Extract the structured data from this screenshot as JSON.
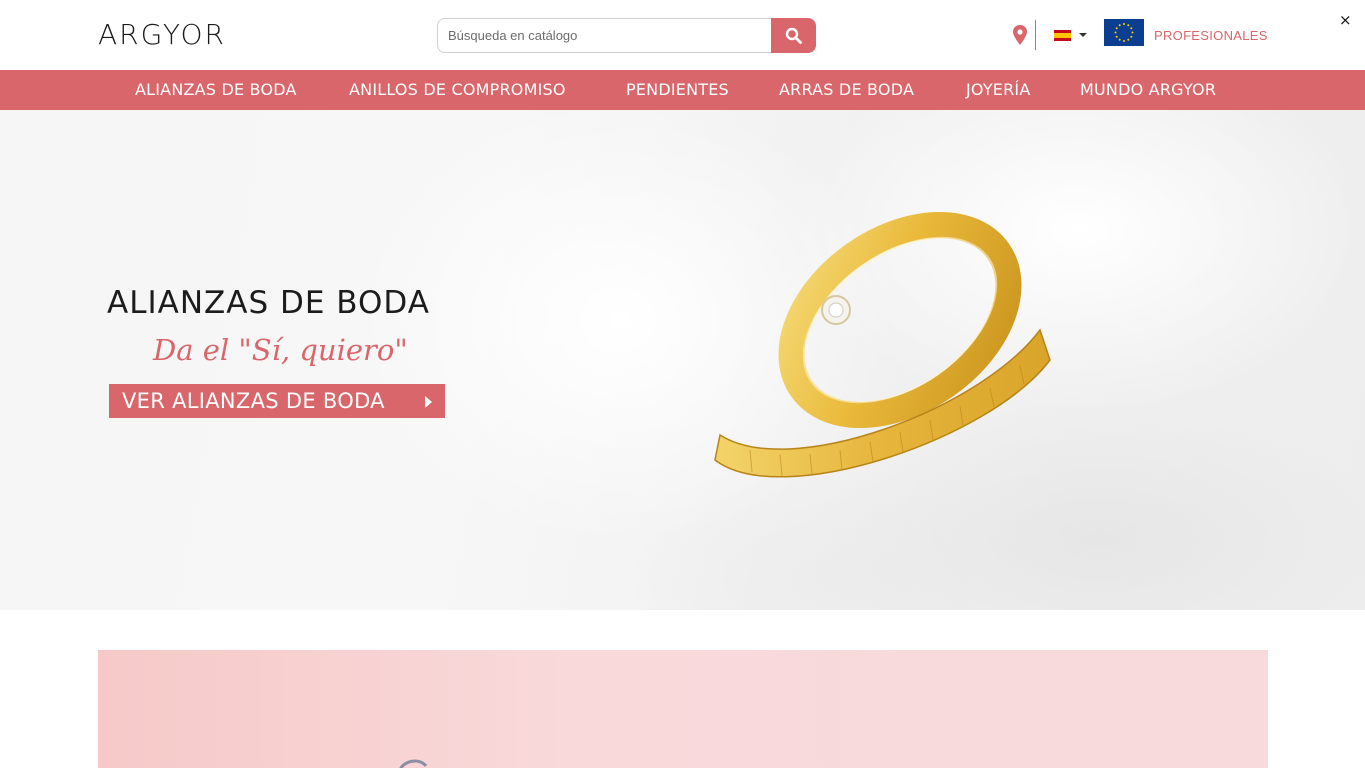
{
  "header": {
    "logo": "ARGYOR",
    "search": {
      "placeholder": "Búsqueda en catálogo"
    },
    "icons": {
      "store_locator": "map-pin-icon",
      "search": "search-icon",
      "flag": "spain-flag-icon",
      "eu": "eu-flag-icon"
    },
    "professionals_label": "PROFESIONALES",
    "close_label": "×"
  },
  "nav": {
    "items": [
      {
        "label": "ALIANZAS DE BODA"
      },
      {
        "label": "ANILLOS DE COMPROMISO"
      },
      {
        "label": "PENDIENTES"
      },
      {
        "label": "ARRAS DE BODA"
      },
      {
        "label": "JOYERÍA"
      },
      {
        "label": "MUNDO ARGYOR"
      }
    ]
  },
  "hero": {
    "title": "ALIANZAS DE BODA",
    "subtitle": "Da el \"Sí, quiero\"",
    "cta_label": "VER ALIANZAS DE BODA"
  },
  "colors": {
    "accent": "#d9666a",
    "nav_bg": "#d9666a",
    "promo_bg": "#f7d3d4"
  }
}
